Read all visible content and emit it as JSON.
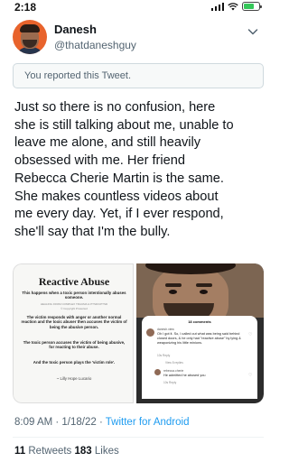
{
  "status_bar": {
    "time": "2:18"
  },
  "author": {
    "name": "Danesh",
    "handle": "@thatdaneshguy"
  },
  "notice": "You reported this Tweet.",
  "tweet": {
    "lines": [
      "Just so there is no confusion, here",
      "she is still talking about me, unable to",
      "leave me alone, and still heavily",
      "obsessed with me. Her friend",
      "Rebecca Cherie Martin is the same.",
      "She makes countless videos about",
      "me every day. Yet, if I ever respond,",
      "she'll say that I'm the bully."
    ]
  },
  "media_left": {
    "title": "Reactive Abuse",
    "intro": "This happens when a toxic person intentionally abuses someone.",
    "source": "HEALING FROM COMPLEX TRAUMA & PTSD/CPTSD",
    "copyright": "© Copyright Protected",
    "p1": "The victim responds with anger or another normal reaction and the toxic abuser then accuses the victim of being the abusive person.",
    "p2": "The toxic person accuses the victim of being abusive, for reacting to their abuse.",
    "p3": "And the toxic person plays the 'victim role'.",
    "author": "~ Lilly Hope Lucario"
  },
  "media_right": {
    "comments_header": "18 comments",
    "comments": [
      {
        "user": "danesh.view",
        "text": "Oh I got it. So, I called out what was being said behind closed doors, & he only had \"reactive abuse\" by lying & weaponizing his little minions.",
        "meta": "10s   Reply"
      },
      {
        "user": "",
        "text": "",
        "meta": "View 8 replies"
      },
      {
        "user": "rebecca.cherie",
        "text": "He admitted he abused you",
        "meta": "10s   Reply"
      }
    ]
  },
  "timestamp": {
    "time_date": "8:09 AM · 1/18/22 · ",
    "source": "Twitter for Android"
  },
  "stats": {
    "retweets_count": "11",
    "retweets_label": " Retweets  ",
    "likes_count": "183",
    "likes_label": " Likes"
  }
}
